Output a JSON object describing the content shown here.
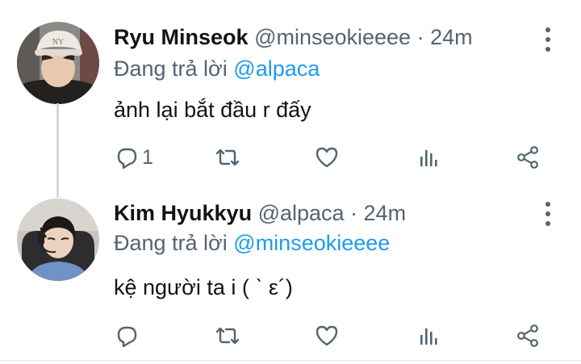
{
  "colors": {
    "text": "#0f1419",
    "secondary": "#536471",
    "link": "#1d9bf0",
    "border": "#e1e8ed"
  },
  "tweets": [
    {
      "display_name": "Ryu Minseok",
      "meta": "@minseokieeee · 24m",
      "reply_prefix": "Đang trả lời",
      "reply_to": "@alpaca",
      "text": "ảnh lại bắt đầu r đấy",
      "reply_count": "1",
      "avatar_icon": "avatar-photo"
    },
    {
      "display_name": "Kim Hyukkyu",
      "meta": "@alpaca · 24m",
      "reply_prefix": "Đang trả lời",
      "reply_to": "@minseokieeee",
      "text": "kệ người ta i ( ˋ ε´)",
      "reply_count": "",
      "avatar_icon": "avatar-photo"
    }
  ],
  "icons": {
    "reply": "reply-icon",
    "retweet": "retweet-icon",
    "like": "heart-icon",
    "stats": "stats-icon",
    "share": "share-icon",
    "more": "more-vertical-icon"
  }
}
